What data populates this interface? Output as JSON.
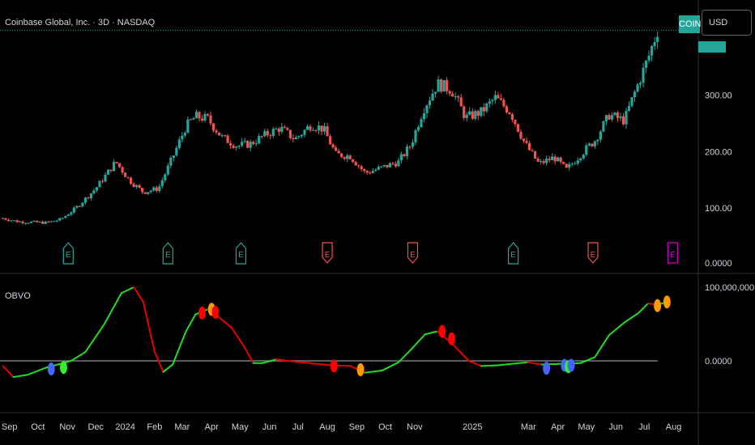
{
  "header": {
    "symbol_title": "Coinbase Global, Inc. · 3D · NASDAQ",
    "ticker_badge": "COIN",
    "currency_button": "USD"
  },
  "indicator": {
    "name": "OBVO"
  },
  "colors": {
    "up": "#26a69a",
    "down": "#ef5350",
    "obvo_up": "#22dd22",
    "obvo_down": "#e60000",
    "zero_line": "#787b86",
    "earnings_pos": "#26a69a",
    "earnings_neg": "#ef5350",
    "earnings_next": "#cc00cc",
    "signal_red": "#ff0000",
    "signal_orange": "#ff9900",
    "signal_blue": "#4466ff",
    "signal_green": "#33ee33"
  },
  "chart_data": [
    {
      "type": "candlestick",
      "title": "Coinbase Global, Inc. · 3D · NASDAQ",
      "y_ticks": [
        "100.00",
        "200.00",
        "300.00",
        "0.0000"
      ],
      "ylim": [
        0,
        420
      ],
      "x_ticks": [
        "Sep",
        "Oct",
        "Nov",
        "Dec",
        "2024",
        "Feb",
        "Mar",
        "Apr",
        "May",
        "Jun",
        "Jul",
        "Aug",
        "Sep",
        "Oct",
        "Nov",
        "2025",
        "Mar",
        "Apr",
        "May",
        "Jun",
        "Jul",
        "Aug"
      ],
      "close_path": [
        [
          "2023-08-25",
          82
        ],
        [
          "2023-09-10",
          76
        ],
        [
          "2023-10-10",
          74
        ],
        [
          "2023-10-25",
          80
        ],
        [
          "2023-11-10",
          100
        ],
        [
          "2023-12-01",
          135
        ],
        [
          "2023-12-22",
          182
        ],
        [
          "2024-01-05",
          150
        ],
        [
          "2024-01-20",
          128
        ],
        [
          "2024-02-05",
          135
        ],
        [
          "2024-02-20",
          190
        ],
        [
          "2024-03-05",
          245
        ],
        [
          "2024-03-15",
          262
        ],
        [
          "2024-03-28",
          258
        ],
        [
          "2024-04-12",
          225
        ],
        [
          "2024-04-28",
          210
        ],
        [
          "2024-05-12",
          214
        ],
        [
          "2024-05-28",
          230
        ],
        [
          "2024-06-12",
          242
        ],
        [
          "2024-06-28",
          222
        ],
        [
          "2024-07-15",
          248
        ],
        [
          "2024-07-28",
          240
        ],
        [
          "2024-08-10",
          195
        ],
        [
          "2024-08-25",
          192
        ],
        [
          "2024-09-10",
          162
        ],
        [
          "2024-09-28",
          172
        ],
        [
          "2024-10-15",
          182
        ],
        [
          "2024-10-28",
          212
        ],
        [
          "2024-11-10",
          275
        ],
        [
          "2024-11-25",
          320
        ],
        [
          "2024-12-10",
          310
        ],
        [
          "2024-12-25",
          260
        ],
        [
          "2025-01-10",
          270
        ],
        [
          "2025-01-25",
          295
        ],
        [
          "2025-02-10",
          270
        ],
        [
          "2025-02-25",
          215
        ],
        [
          "2025-03-12",
          178
        ],
        [
          "2025-03-28",
          190
        ],
        [
          "2025-04-10",
          168
        ],
        [
          "2025-04-25",
          195
        ],
        [
          "2025-05-10",
          220
        ],
        [
          "2025-05-25",
          265
        ],
        [
          "2025-06-10",
          255
        ],
        [
          "2025-06-20",
          300
        ],
        [
          "2025-07-05",
          365
        ],
        [
          "2025-07-15",
          415
        ]
      ],
      "earnings_events": [
        {
          "date": "2023-11-02",
          "label": "E",
          "result": "beat"
        },
        {
          "date": "2024-02-15",
          "label": "E",
          "result": "beat"
        },
        {
          "date": "2024-05-02",
          "label": "E",
          "result": "beat"
        },
        {
          "date": "2024-08-01",
          "label": "E",
          "result": "miss"
        },
        {
          "date": "2024-10-30",
          "label": "E",
          "result": "miss"
        },
        {
          "date": "2025-02-13",
          "label": "E",
          "result": "beat"
        },
        {
          "date": "2025-05-08",
          "label": "E",
          "result": "miss"
        },
        {
          "date": "2025-07-31",
          "label": "E",
          "result": "upcoming"
        }
      ]
    },
    {
      "type": "line",
      "title": "OBVO",
      "y_ticks": [
        "100,000,000.00",
        "0.0000"
      ],
      "ylim": [
        -35000000,
        115000000
      ],
      "zero_line": 0,
      "series": [
        {
          "values": [
            [
              "2023-08-25",
              -7000000
            ],
            [
              "2023-09-05",
              -22000000
            ],
            [
              "2023-09-20",
              -19000000
            ],
            [
              "2023-10-10",
              -9000000
            ],
            [
              "2023-10-25",
              -4000000
            ],
            [
              "2023-11-05",
              0
            ],
            [
              "2023-11-20",
              12000000
            ],
            [
              "2023-12-10",
              50000000
            ],
            [
              "2023-12-28",
              92000000
            ],
            [
              "2024-01-10",
              100000000
            ],
            [
              "2024-01-20",
              80000000
            ],
            [
              "2024-02-01",
              12000000
            ],
            [
              "2024-02-10",
              -15000000
            ],
            [
              "2024-02-20",
              -5000000
            ],
            [
              "2024-03-05",
              40000000
            ],
            [
              "2024-03-15",
              63000000
            ],
            [
              "2024-03-28",
              70000000
            ],
            [
              "2024-04-08",
              60000000
            ],
            [
              "2024-04-22",
              45000000
            ],
            [
              "2024-05-05",
              20000000
            ],
            [
              "2024-05-15",
              -3000000
            ],
            [
              "2024-05-25",
              -3000000
            ],
            [
              "2024-06-08",
              2000000
            ],
            [
              "2024-06-20",
              0
            ],
            [
              "2024-07-05",
              -2000000
            ],
            [
              "2024-07-20",
              -4000000
            ],
            [
              "2024-08-05",
              -6000000
            ],
            [
              "2024-08-25",
              -7000000
            ],
            [
              "2024-09-10",
              -16000000
            ],
            [
              "2024-09-28",
              -13000000
            ],
            [
              "2024-10-15",
              -2000000
            ],
            [
              "2024-10-28",
              15000000
            ],
            [
              "2024-11-12",
              36000000
            ],
            [
              "2024-11-25",
              40000000
            ],
            [
              "2024-12-10",
              24000000
            ],
            [
              "2024-12-28",
              0
            ],
            [
              "2025-01-10",
              -7000000
            ],
            [
              "2025-01-28",
              -6000000
            ],
            [
              "2025-02-12",
              -4000000
            ],
            [
              "2025-02-28",
              -2000000
            ],
            [
              "2025-03-15",
              -5000000
            ],
            [
              "2025-04-05",
              -4000000
            ],
            [
              "2025-04-25",
              -3000000
            ],
            [
              "2025-05-10",
              5000000
            ],
            [
              "2025-05-25",
              35000000
            ],
            [
              "2025-06-10",
              52000000
            ],
            [
              "2025-06-25",
              65000000
            ],
            [
              "2025-07-05",
              78000000
            ],
            [
              "2025-07-15",
              76000000
            ],
            [
              "2025-07-25",
              80000000
            ]
          ]
        }
      ],
      "signals": [
        {
          "date": "2023-10-15",
          "value": -11000000,
          "kind": "blue"
        },
        {
          "date": "2023-10-28",
          "value": -9000000,
          "kind": "green"
        },
        {
          "date": "2024-03-22",
          "value": 65000000,
          "kind": "red"
        },
        {
          "date": "2024-04-01",
          "value": 70000000,
          "kind": "orange"
        },
        {
          "date": "2024-04-05",
          "value": 66000000,
          "kind": "red"
        },
        {
          "date": "2024-08-08",
          "value": -7000000,
          "kind": "red"
        },
        {
          "date": "2024-09-05",
          "value": -12000000,
          "kind": "orange"
        },
        {
          "date": "2024-11-30",
          "value": 40000000,
          "kind": "red"
        },
        {
          "date": "2024-12-10",
          "value": 30000000,
          "kind": "red"
        },
        {
          "date": "2025-03-20",
          "value": -10000000,
          "kind": "blue"
        },
        {
          "date": "2025-04-08",
          "value": -6000000,
          "kind": "blue"
        },
        {
          "date": "2025-04-12",
          "value": -8000000,
          "kind": "green"
        },
        {
          "date": "2025-04-15",
          "value": -6000000,
          "kind": "blue"
        },
        {
          "date": "2025-07-15",
          "value": 75000000,
          "kind": "orange"
        },
        {
          "date": "2025-07-25",
          "value": 80000000,
          "kind": "orange"
        }
      ]
    }
  ]
}
